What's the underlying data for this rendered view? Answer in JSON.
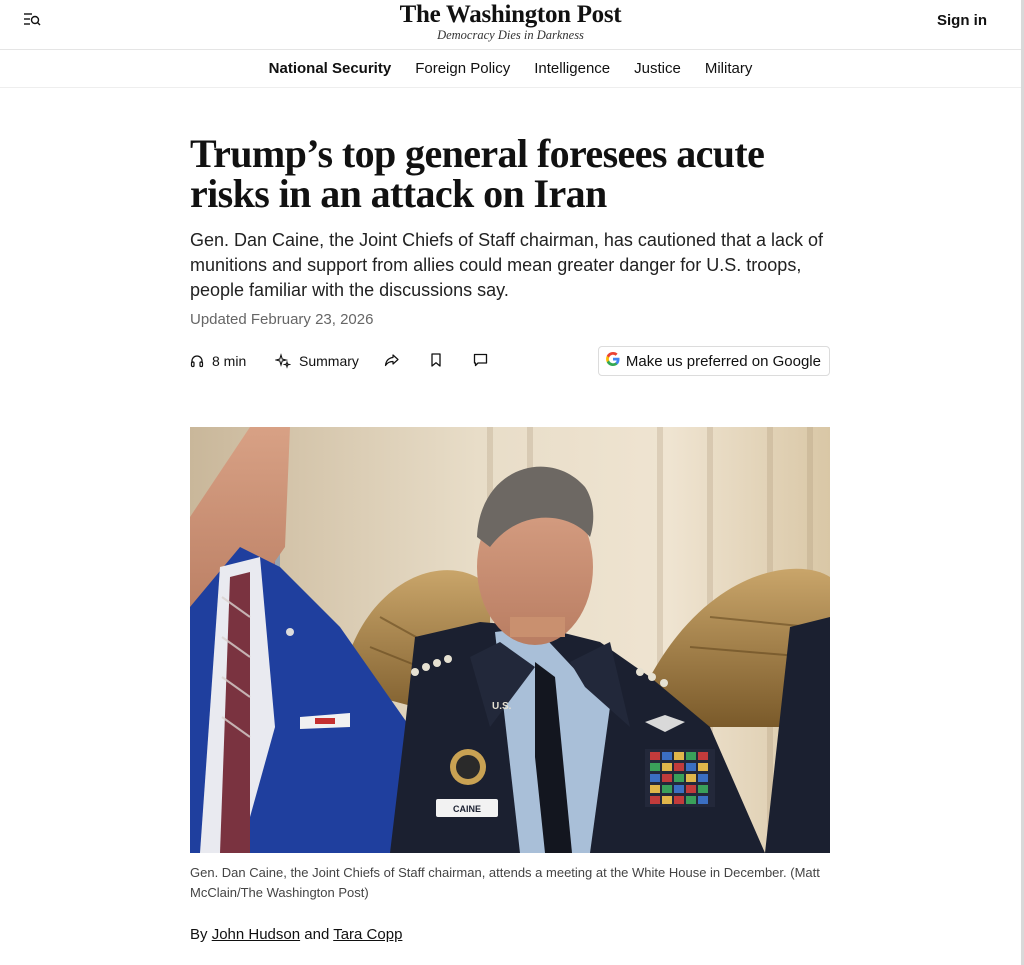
{
  "masthead": {
    "brand_name": "The Washington Post",
    "tagline": "Democracy Dies in Darkness",
    "sign_in_label": "Sign in",
    "menu_icon": "menu-search-icon"
  },
  "subnav": {
    "items": [
      {
        "label": "National Security",
        "active": true
      },
      {
        "label": "Foreign Policy",
        "active": false
      },
      {
        "label": "Intelligence",
        "active": false
      },
      {
        "label": "Justice",
        "active": false
      },
      {
        "label": "Military",
        "active": false
      }
    ]
  },
  "article": {
    "headline": "Trump’s top general foresees acute risks in an attack on Iran",
    "dek": "Gen. Dan Caine, the Joint Chiefs of Staff chairman, has cautioned that a lack of munitions and support from allies could mean greater danger for U.S. troops, people familiar with the discussions say.",
    "updated": "Updated February 23, 2026",
    "actions": {
      "listen_label": "8 min",
      "summary_label": "Summary",
      "google_label": "Make us preferred on Google",
      "icons": [
        "headphones-icon",
        "sparkle-icon",
        "share-icon",
        "bookmark-icon",
        "comment-icon",
        "google-logo-icon"
      ]
    },
    "photo": {
      "caption": "Gen. Dan Caine, the Joint Chiefs of Staff chairman, attends a meeting at the White House in December. (Matt McClain/The Washington Post)",
      "nametag": "CAINE",
      "collar": "U.S."
    },
    "byline": {
      "prefix": "By",
      "author1": "John Hudson",
      "joiner": "and",
      "author2": "Tara Copp"
    }
  },
  "colors": {
    "text": "#111111",
    "muted": "#666666",
    "google_blue": "#4285F4",
    "uniform": "#1b2030",
    "suit": "#1f3f9e"
  }
}
